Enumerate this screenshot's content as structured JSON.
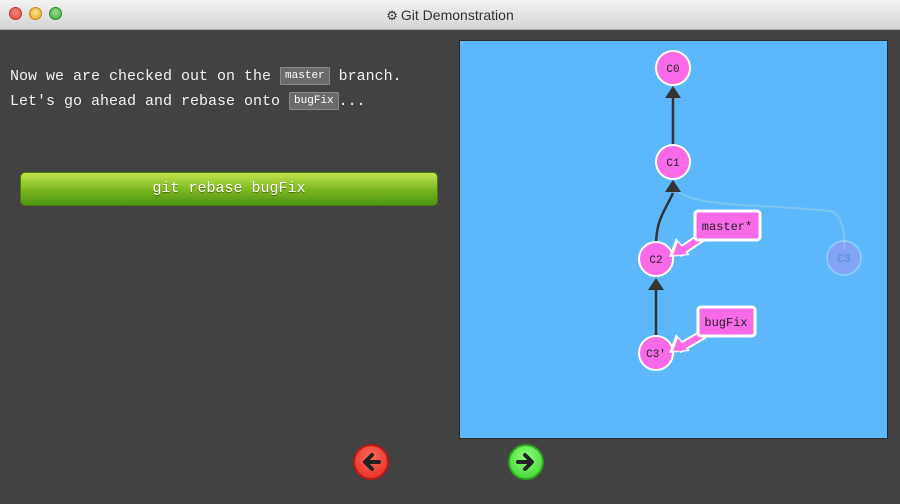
{
  "window": {
    "title": "Git Demonstration",
    "title_icon": "gear-icon"
  },
  "instructions": {
    "line1_prefix": "Now we are checked out on the ",
    "line1_code": "master",
    "line1_suffix": " branch.",
    "line2_prefix": "Let's go ahead and rebase onto ",
    "line2_code": "bugFix",
    "line2_suffix": "..."
  },
  "command_button": {
    "label": "git rebase bugFix"
  },
  "graph": {
    "commits": [
      {
        "id": "C0",
        "label": "C0",
        "faded": false
      },
      {
        "id": "C1",
        "label": "C1",
        "faded": false
      },
      {
        "id": "C2",
        "label": "C2",
        "faded": false
      },
      {
        "id": "C3",
        "label": "C3",
        "faded": true
      },
      {
        "id": "C3p",
        "label": "C3'",
        "faded": false
      }
    ],
    "branches": [
      {
        "name": "master*",
        "target": "C2"
      },
      {
        "name": "bugFix",
        "target": "C3p"
      }
    ]
  },
  "navigation": {
    "prev_icon": "arrow-left-icon",
    "next_icon": "arrow-right-icon"
  },
  "colors": {
    "canvas_bg": "#5cb8fb",
    "commit_fill": "#f96ae8",
    "button_green": "#79b51e"
  }
}
